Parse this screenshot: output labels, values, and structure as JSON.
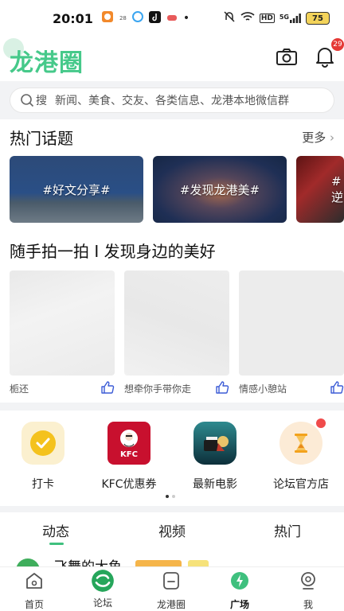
{
  "status_bar": {
    "time": "20:01",
    "battery": "75",
    "icons": [
      "app-notification-icon",
      "calendar-icon",
      "qq-browser-icon",
      "tiktok-icon",
      "game-icon",
      "dot-icon",
      "mute-icon",
      "wifi-icon",
      "hd-icon",
      "signal-5g-icon",
      "battery-icon"
    ],
    "calendar_day": "28",
    "hd_label": "HD",
    "net_label": "5G"
  },
  "header": {
    "logo": "龙港圈",
    "notification_count": "29"
  },
  "search": {
    "prefix": "搜",
    "placeholder": "新闻、美食、交友、各类信息、龙港本地微信群"
  },
  "hot_topics": {
    "title": "热门话题",
    "more": "更多",
    "items": [
      {
        "label": "#好文分享#"
      },
      {
        "label": "#发现龙港美#"
      },
      {
        "label": "#逆"
      }
    ]
  },
  "photo_section": {
    "title": "随手拍一拍 I 发现身边的美好",
    "items": [
      {
        "caption": "栀还"
      },
      {
        "caption": "想牵你手带你走"
      },
      {
        "caption": "情感小憩站"
      }
    ]
  },
  "quick_tools": [
    {
      "label": "打卡",
      "icon": "check-in-icon"
    },
    {
      "label": "KFC优惠券",
      "icon": "kfc-icon"
    },
    {
      "label": "最新电影",
      "icon": "movie-icon"
    },
    {
      "label": "论坛官方店",
      "icon": "hourglass-icon"
    }
  ],
  "kfc_logo_text": "KFC",
  "feed": {
    "tabs": [
      "动态",
      "视频",
      "热门"
    ],
    "active_tab": "动态",
    "peek_name": "飞舞的大鱼"
  },
  "bottom_nav": {
    "items": [
      {
        "label": "首页",
        "icon": "home-icon"
      },
      {
        "label": "论坛",
        "icon": "forum-icon"
      },
      {
        "label": "龙港圈",
        "icon": "circle-icon"
      },
      {
        "label": "广场",
        "icon": "plaza-icon"
      },
      {
        "label": "我",
        "icon": "profile-icon"
      }
    ],
    "active": "广场"
  },
  "colors": {
    "brand_green": "#46c98a",
    "badge_red": "#e53935",
    "kfc_red": "#c8102e"
  }
}
